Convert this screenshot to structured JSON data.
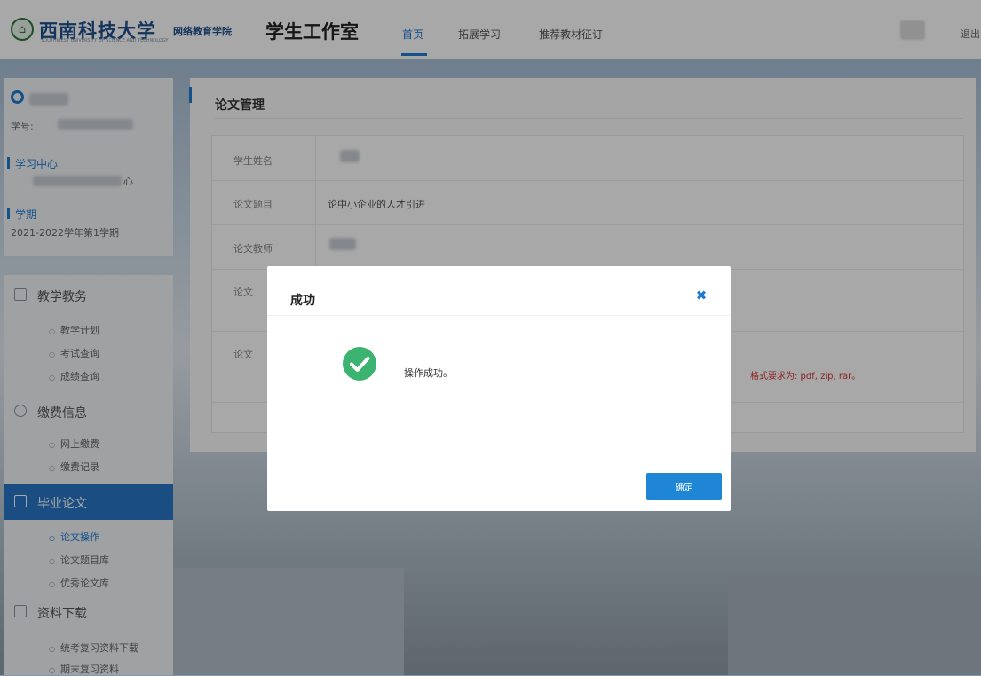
{
  "header": {
    "university_name": "西南科技大学",
    "college_name": "网络教育学院",
    "studio_title": "学生工作室",
    "nav": [
      "首页",
      "拓展学习",
      "推荐教材征订"
    ],
    "logout": "退出"
  },
  "profile": {
    "student_id_label": "学号:",
    "study_center_label": "学习中心",
    "study_center_value_suffix": "心",
    "term_label": "学期",
    "term_value": "2021-2022学年第1学期"
  },
  "menu": {
    "sections": [
      {
        "label": "教学教务",
        "icon": "grid-icon",
        "items": [
          "教学计划",
          "考试查询",
          "成绩查询"
        ]
      },
      {
        "label": "缴费信息",
        "icon": "coin-icon",
        "items": [
          "网上缴费",
          "缴费记录"
        ]
      },
      {
        "label": "毕业论文",
        "icon": "paper-icon",
        "active": true,
        "items": [
          "论文操作",
          "论文题目库",
          "优秀论文库"
        ]
      },
      {
        "label": "资料下载",
        "icon": "download-icon",
        "items": [
          "统考复习资料下载",
          "期末复习资料"
        ]
      }
    ],
    "active_item": "论文操作"
  },
  "main": {
    "title": "论文管理",
    "rows": [
      {
        "label": "学生姓名",
        "value": ""
      },
      {
        "label": "论文题目",
        "value": "论中小企业的人才引进"
      },
      {
        "label": "论文教师",
        "value": ""
      },
      {
        "label": "论文",
        "value": ""
      },
      {
        "label": "论文",
        "value": ""
      }
    ],
    "red_note": "格式要求为: pdf, zip, rar。"
  },
  "dialog": {
    "title": "成功",
    "close_symbol": "✖",
    "message": "操作成功。",
    "ok_label": "确定",
    "success_color": "#3cb371",
    "accent_color": "#1e86d4"
  }
}
